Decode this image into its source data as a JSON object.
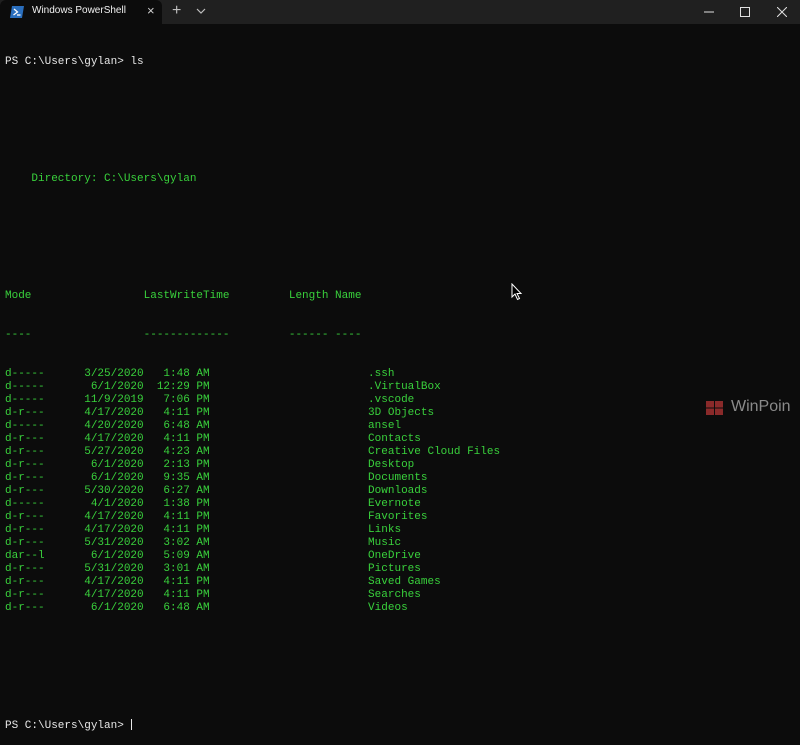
{
  "window": {
    "tab_title": "Windows PowerShell",
    "tab_icon": "powershell-icon",
    "new_tab_symbol": "+",
    "close_symbol": "×"
  },
  "terminal": {
    "prompt_line": "PS C:\\Users\\gylan> ls",
    "directory_line": "    Directory: C:\\Users\\gylan",
    "header_line": "Mode                 LastWriteTime         Length Name",
    "separator_line": "----                 -------------         ------ ----",
    "entries": [
      {
        "mode": "d-----",
        "date": "3/25/2020",
        "time": "1:48 AM",
        "name": ".ssh"
      },
      {
        "mode": "d-----",
        "date": "6/1/2020",
        "time": "12:29 PM",
        "name": ".VirtualBox"
      },
      {
        "mode": "d-----",
        "date": "11/9/2019",
        "time": "7:06 PM",
        "name": ".vscode"
      },
      {
        "mode": "d-r---",
        "date": "4/17/2020",
        "time": "4:11 PM",
        "name": "3D Objects"
      },
      {
        "mode": "d-----",
        "date": "4/20/2020",
        "time": "6:48 AM",
        "name": "ansel"
      },
      {
        "mode": "d-r---",
        "date": "4/17/2020",
        "time": "4:11 PM",
        "name": "Contacts"
      },
      {
        "mode": "d-r---",
        "date": "5/27/2020",
        "time": "4:23 AM",
        "name": "Creative Cloud Files"
      },
      {
        "mode": "d-r---",
        "date": "6/1/2020",
        "time": "2:13 PM",
        "name": "Desktop"
      },
      {
        "mode": "d-r---",
        "date": "6/1/2020",
        "time": "9:35 AM",
        "name": "Documents"
      },
      {
        "mode": "d-r---",
        "date": "5/30/2020",
        "time": "6:27 AM",
        "name": "Downloads"
      },
      {
        "mode": "d-----",
        "date": "4/1/2020",
        "time": "1:38 PM",
        "name": "Evernote"
      },
      {
        "mode": "d-r---",
        "date": "4/17/2020",
        "time": "4:11 PM",
        "name": "Favorites"
      },
      {
        "mode": "d-r---",
        "date": "4/17/2020",
        "time": "4:11 PM",
        "name": "Links"
      },
      {
        "mode": "d-r---",
        "date": "5/31/2020",
        "time": "3:02 AM",
        "name": "Music"
      },
      {
        "mode": "dar--l",
        "date": "6/1/2020",
        "time": "5:09 AM",
        "name": "OneDrive"
      },
      {
        "mode": "d-r---",
        "date": "5/31/2020",
        "time": "3:01 AM",
        "name": "Pictures"
      },
      {
        "mode": "d-r---",
        "date": "4/17/2020",
        "time": "4:11 PM",
        "name": "Saved Games"
      },
      {
        "mode": "d-r---",
        "date": "4/17/2020",
        "time": "4:11 PM",
        "name": "Searches"
      },
      {
        "mode": "d-r---",
        "date": "6/1/2020",
        "time": "6:48 AM",
        "name": "Videos"
      }
    ],
    "final_prompt": "PS C:\\Users\\gylan> "
  },
  "watermark": {
    "text": "WinPoin",
    "logo": "winpoin-logo"
  },
  "colors": {
    "background": "#0c0c0c",
    "titlebar": "#202020",
    "output_green": "#39d13c",
    "prompt_text": "#e8e8e8"
  }
}
